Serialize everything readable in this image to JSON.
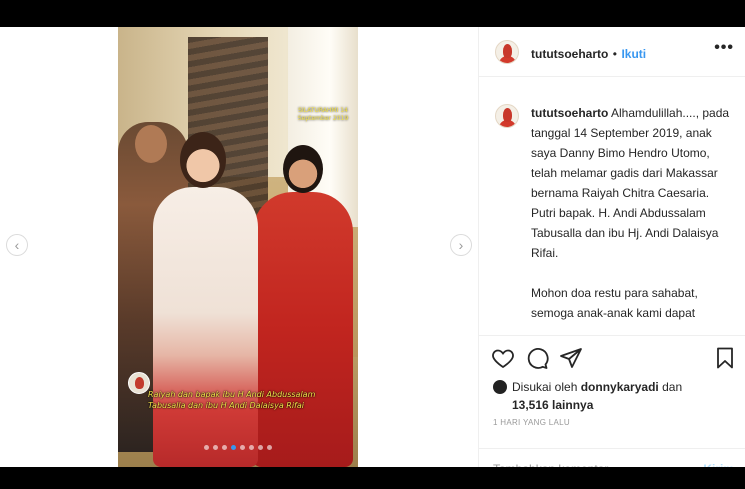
{
  "post": {
    "username": "tututsoeharto",
    "separator": "•",
    "follow_label": "Ikuti",
    "more_icon": "more-dots-icon",
    "caption_para1": "Alhamdulillah...., pada tanggal 14 September 2019, anak saya Danny Bimo Hendro Utomo, telah melamar gadis dari Makassar bernama Raiyah Chitra Caesaria. Putri bapak. H. Andi Abdussalam Tabusalla dan ibu Hj. Andi Dalaisya Rifai.",
    "caption_para2": "Mohon doa restu para sahabat, semoga anak-anak kami dapat"
  },
  "photo": {
    "overlay_top": "SILATURAHMI 14 September 2019",
    "overlay_bottom": "Raiyah dan bapak ibu H Andi Abdussalam Tabusalla dan ibu H Andi Dalaisya Rifai",
    "carousel_dot_count": 8,
    "carousel_active_index": 3
  },
  "engagement": {
    "liked_by_prefix": "Disukai oleh",
    "liked_by_user": "donnykaryadi",
    "and_label": "dan",
    "others_count": "13,516 lainnya",
    "timestamp": "1 HARI YANG LALU"
  },
  "comment_box": {
    "placeholder": "Tambahkan komentar...",
    "send_label": "Kirim"
  },
  "colors": {
    "accent": "#3897f0",
    "send_disabled": "#b2dffc",
    "muted": "#999999"
  }
}
